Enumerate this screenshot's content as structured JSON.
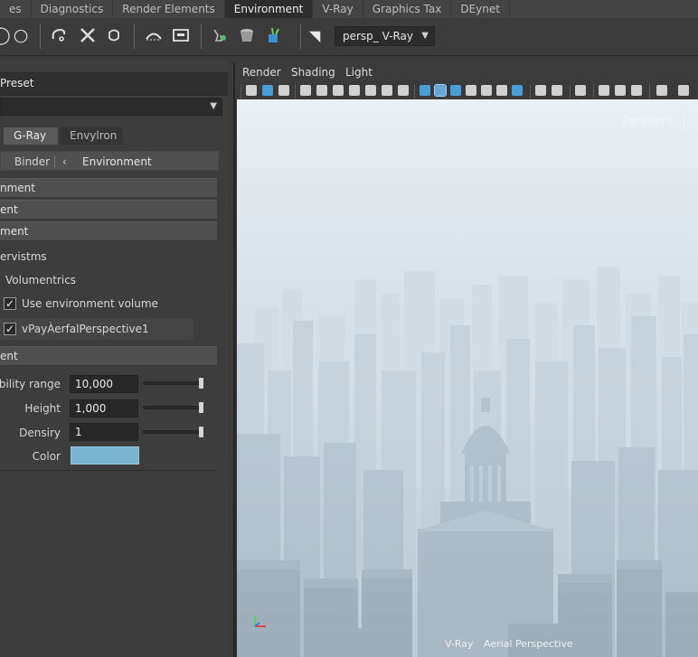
{
  "tabs": [
    "es",
    "Diagnostics",
    "Render Elements",
    "Environment",
    "V-Ray",
    "Graphics Tax",
    "DEynet"
  ],
  "active_tab": "Environment",
  "toolbar": {
    "camera_select": "persp_ V-Ray",
    "icons": [
      "circle-icon",
      "circle-outline-icon",
      "lasso-icon",
      "close-icon",
      "rotate-icon",
      "arc-icon",
      "frame-icon",
      "paint-icon",
      "pot-icon",
      "plant-icon",
      "camera-icon"
    ]
  },
  "left_panel": {
    "preset_title": "Preset",
    "preset_value": "",
    "subtabs": [
      "G-Ray",
      "Envylron"
    ],
    "nav": {
      "binder": "Binder",
      "symbol": "‹",
      "environment": "Environment"
    },
    "sections": [
      "nment",
      "ent",
      "ment"
    ],
    "overvism_label": "ervistms",
    "volumetrics_label": "Volumentrics",
    "use_env_volume": {
      "label": "Use environment volume",
      "checked": true
    },
    "aerial": {
      "label": "vPayÀerfalPerspective1",
      "checked": true
    },
    "attr_section": "ent",
    "attributes": [
      {
        "label": "bility range",
        "value": "10,000",
        "slider": 1.0
      },
      {
        "label": "Height",
        "value": "1,000",
        "slider": 1.0
      },
      {
        "label": "Densiry",
        "value": "1",
        "slider": 1.0
      }
    ],
    "color_label": "Color",
    "color_value": "#7ab3cc"
  },
  "viewport": {
    "menu": [
      "Render",
      "Shading",
      "Light"
    ],
    "camera_name": "Persders",
    "footer_renderer": "V-Ray",
    "footer_effect": "Aerial Perspective"
  },
  "colors": {
    "sky_top": "#e8eef2",
    "haze": "#c9d6df",
    "city_far": "#c2cfd8",
    "city_near": "#8f9fac"
  }
}
